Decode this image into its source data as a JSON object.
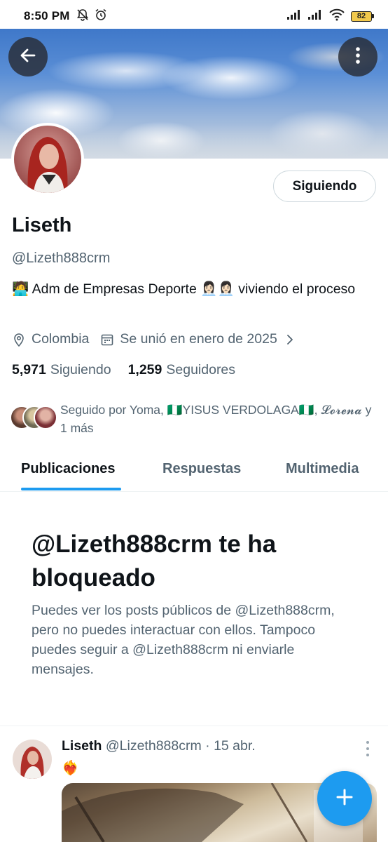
{
  "status_bar": {
    "time": "8:50 PM",
    "battery": "82"
  },
  "profile": {
    "follow_button": "Siguiendo",
    "name": "Liseth",
    "handle": "@Lizeth888crm",
    "bio": "🧑‍💻 Adm de Empresas Deporte 👩🏻‍💼👩🏻‍💼 viviendo el proceso",
    "location": "Colombia",
    "joined": "Se unió en enero de 2025",
    "following_count": "5,971",
    "following_label": "Siguiendo",
    "followers_count": "1,259",
    "followers_label": "Seguidores",
    "followed_by": "Seguido por Yoma, 🇳🇬YISUS VERDOLAGA🇳🇬, 𝓛𝓸𝓻𝓮𝓷𝓪 y 1 más"
  },
  "tabs": [
    {
      "label": "Publicaciones",
      "active": true
    },
    {
      "label": "Respuestas",
      "active": false
    },
    {
      "label": "Multimedia",
      "active": false
    }
  ],
  "blocked": {
    "title": "@Lizeth888crm te ha bloqueado",
    "text": "Puedes ver los posts públicos de @Lizeth888crm, pero no puedes interactuar con ellos. Tampoco puedes seguir a @Lizeth888crm ni enviarle mensajes."
  },
  "post": {
    "author_name": "Liseth",
    "author_handle": "@Lizeth888crm",
    "separator": "·",
    "date": "15 abr.",
    "content": "❤️‍🔥"
  },
  "colors": {
    "accent": "#1d9bf0",
    "text_primary": "#0f1419",
    "text_secondary": "#536471",
    "border": "#cfd9de"
  },
  "icons": {
    "back": "arrow-left-icon",
    "more": "more-vertical-icon",
    "location": "location-pin-icon",
    "calendar": "calendar-icon",
    "chevron": "chevron-right-icon",
    "compose": "plus-icon",
    "mute": "bell-off-icon",
    "alarm": "alarm-icon",
    "wifi": "wifi-icon",
    "signal": "signal-icon",
    "battery": "battery-icon"
  }
}
